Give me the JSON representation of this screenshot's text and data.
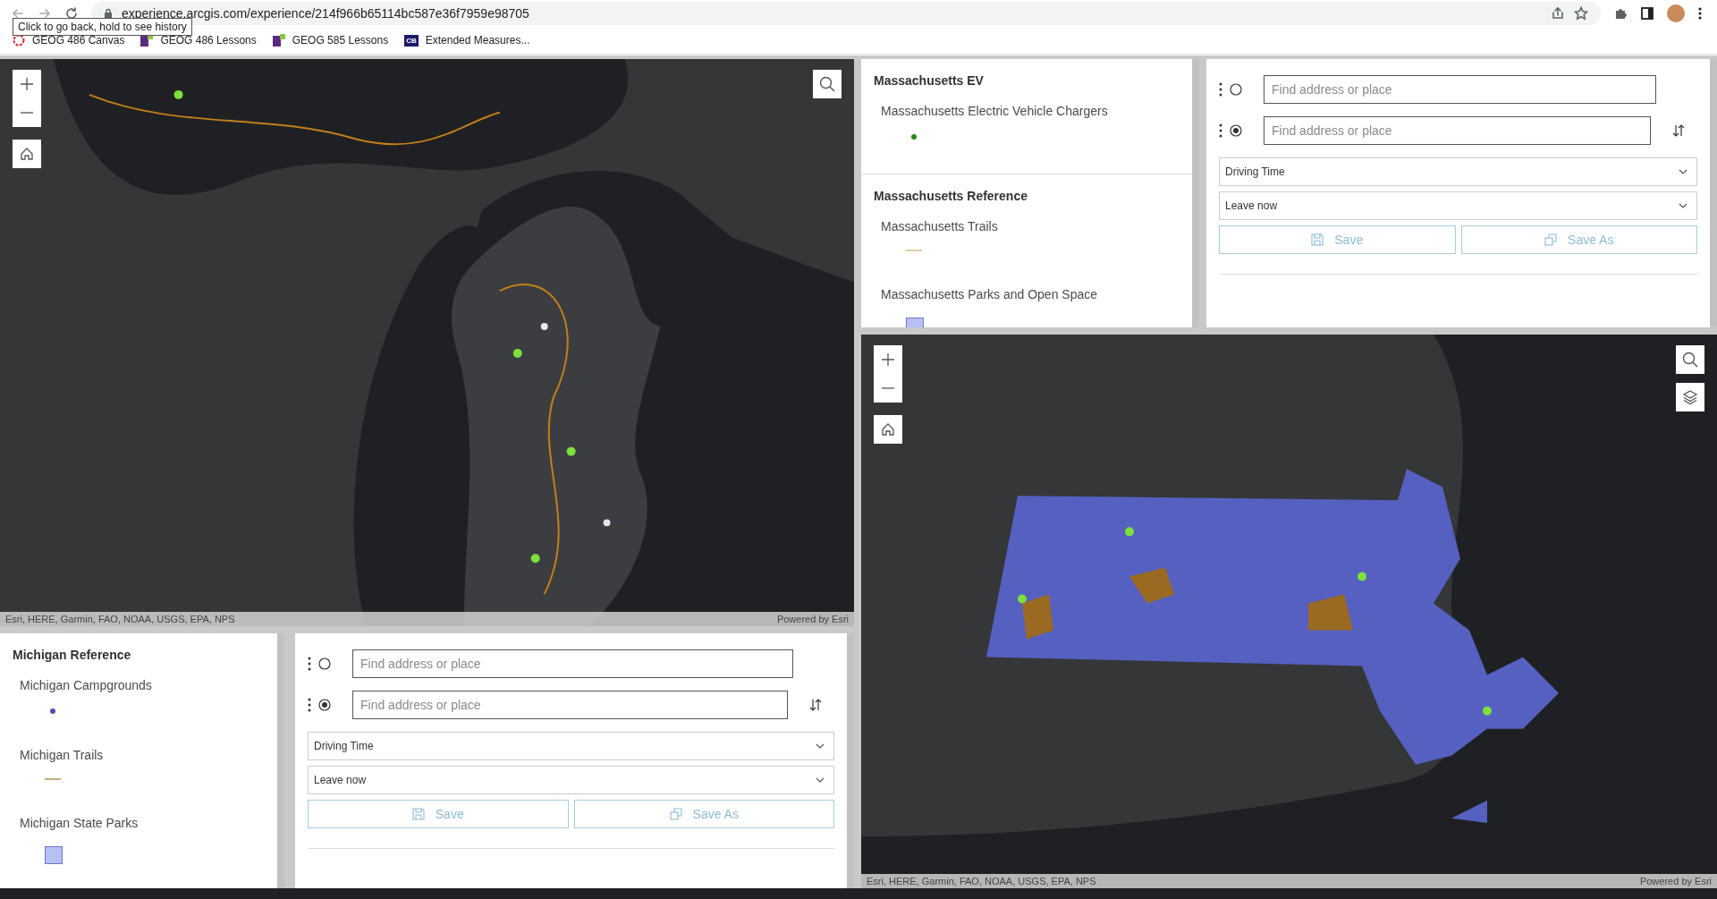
{
  "browser": {
    "url": "experience.arcgis.com/experience/214f966b65114bc587e36f7959e98705",
    "tooltip": "Click to go back, hold to see history",
    "bookmarks": [
      {
        "label": "GEOG 486 Canvas",
        "kind": "ring"
      },
      {
        "label": "GEOG 486 Lessons",
        "kind": "squares"
      },
      {
        "label": "GEOG 585 Lessons",
        "kind": "squares"
      },
      {
        "label": "Extended Measures...",
        "kind": "badge",
        "badge": "CB"
      }
    ]
  },
  "michigan": {
    "map": {
      "kind": "picture",
      "tools": [
        {
          "kind": "search"
        }
      ],
      "attribution": "Esri, HERE, Garmin, FAO, NOAA, USGS, EPA, NPS",
      "powered_by": "Powered by Esri"
    },
    "legend": {
      "groups": [
        {
          "title": "Michigan Reference",
          "layers": [
            {
              "label": "Michigan Campgrounds",
              "kind": "point",
              "color": "#5a4aa8"
            },
            {
              "label": "Michigan Trails",
              "kind": "line",
              "color": "#c9ae7c"
            },
            {
              "label": "Michigan State Parks",
              "kind": "fill",
              "color": "#b7bff5"
            }
          ]
        }
      ]
    },
    "directions": {
      "stops": [
        {
          "placeholder": "Find address or place",
          "kind": "origin"
        },
        {
          "placeholder": "Find address or place",
          "kind": "destination"
        }
      ],
      "mode": "Driving Time",
      "departure": "Leave now",
      "buttons": [
        {
          "label": "Save",
          "kind": "save",
          "disabled": true
        },
        {
          "label": "Save As",
          "kind": "save-as",
          "disabled": true
        }
      ]
    }
  },
  "massachusetts": {
    "legend": {
      "groups": [
        {
          "title": "Massachusetts EV",
          "layers": [
            {
              "label": "Massachusetts Electric Vehicle Chargers",
              "kind": "point",
              "color": "#1f8a10"
            }
          ]
        },
        {
          "title": "Massachusetts Reference",
          "layers": [
            {
              "label": "Massachusetts Trails",
              "kind": "line",
              "color": "#e3cfa3"
            },
            {
              "label": "Massachusetts Parks and Open Space",
              "kind": "fill",
              "color": "#b7bff5"
            }
          ]
        }
      ]
    },
    "directions": {
      "stops": [
        {
          "placeholder": "Find address or place",
          "kind": "origin"
        },
        {
          "placeholder": "Find address or place",
          "kind": "destination"
        }
      ],
      "mode": "Driving Time",
      "departure": "Leave now",
      "buttons": [
        {
          "label": "Save",
          "kind": "save",
          "disabled": true
        },
        {
          "label": "Save As",
          "kind": "save-as",
          "disabled": true
        }
      ]
    },
    "map": {
      "kind": "picture",
      "tools": [
        {
          "kind": "search"
        },
        {
          "kind": "layers"
        }
      ],
      "attribution": "Esri, HERE, Garmin, FAO, NOAA, USGS, EPA, NPS",
      "powered_by": "Powered by Esri"
    }
  }
}
